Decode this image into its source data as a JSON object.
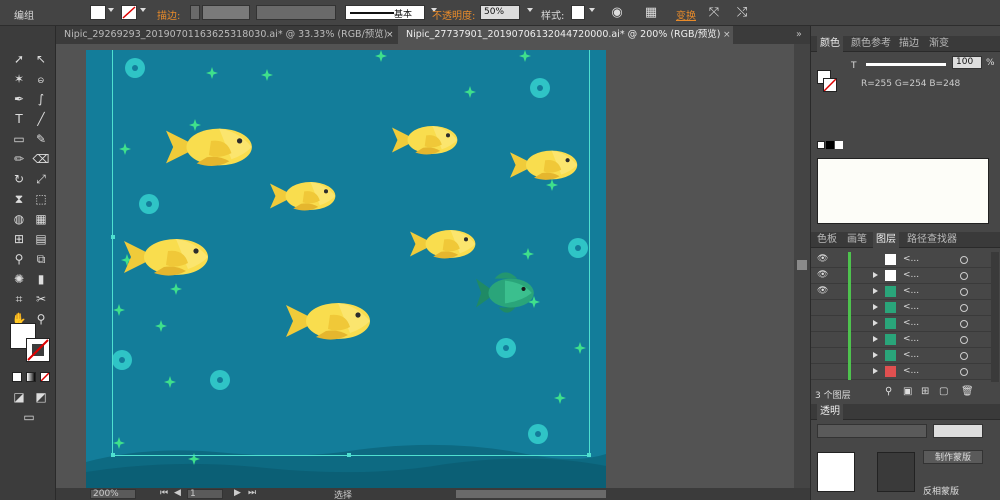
{
  "control_bar": {
    "selection_type": "编组",
    "stroke_label": "描边:",
    "stroke_style": "基本",
    "opacity_label": "不透明度:",
    "opacity_value": "50%",
    "style_label": "样式:",
    "transform_label": "变换"
  },
  "tabs": [
    {
      "label": "Nipic_29269293_20190701163625318030.ai* @ 33.33% (RGB/预览)",
      "active": false
    },
    {
      "label": "Nipic_27737901_20190706132044720000.ai* @ 200% (RGB/预览)",
      "active": true
    }
  ],
  "color_panel": {
    "tabs": [
      "颜色",
      "颜色参考",
      "描边",
      "渐变"
    ],
    "channel_label": "T",
    "tint_value": "100",
    "tint_unit": "%",
    "rgb_readout": "R=255 G=254 B=248"
  },
  "layers_panel": {
    "tabs": [
      "色板",
      "画笔",
      "图层",
      "路径查找器"
    ],
    "rows": [
      {
        "name": "<...",
        "thumb": "#ffffff"
      },
      {
        "name": "<...",
        "thumb": "#ffffff"
      },
      {
        "name": "<...",
        "thumb": "#2aa57a"
      },
      {
        "name": "<...",
        "thumb": "#2aa57a"
      },
      {
        "name": "<...",
        "thumb": "#2aa57a"
      },
      {
        "name": "<...",
        "thumb": "#2aa57a"
      },
      {
        "name": "<...",
        "thumb": "#2aa57a"
      },
      {
        "name": "<...",
        "thumb": "#e05050"
      }
    ],
    "count_label": "3 个图层"
  },
  "transparency_panel": {
    "title": "透明",
    "make_mask": "制作蒙版",
    "invert_mask": "反相蒙版"
  },
  "status_bar": {
    "zoom": "200%",
    "page": "1",
    "tool": "选择"
  },
  "colors": {
    "ocean": "#137d9a",
    "wave": "#0d6a82",
    "fish_yellow": "#f9dd4e",
    "fish_green": "#2aa57a",
    "bubble": "#2fc4c6",
    "sparkle": "#3fe08c",
    "accent_orange": "#e98b2a"
  }
}
